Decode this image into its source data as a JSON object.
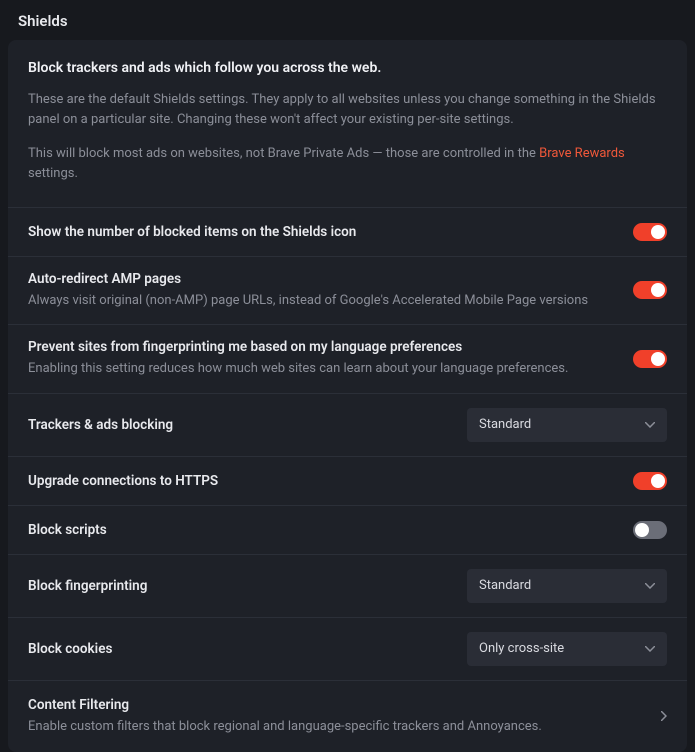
{
  "page_title": "Shields",
  "intro": {
    "title": "Block trackers and ads which follow you across the web.",
    "p1": "These are the default Shields settings. They apply to all websites unless you change something in the Shields panel on a particular site. Changing these won't affect your existing per-site settings.",
    "p2_pre": "This will block most ads on websites, not Brave Private Ads — those are controlled in the ",
    "p2_link": "Brave Rewards",
    "p2_post": " settings."
  },
  "rows": {
    "show_count": {
      "title": "Show the number of blocked items on the Shields icon"
    },
    "amp": {
      "title": "Auto-redirect AMP pages",
      "sub": "Always visit original (non-AMP) page URLs, instead of Google's Accelerated Mobile Page versions"
    },
    "lang_fp": {
      "title": "Prevent sites from fingerprinting me based on my language preferences",
      "sub": "Enabling this setting reduces how much web sites can learn about your language preferences."
    },
    "trackers": {
      "title": "Trackers & ads blocking",
      "value": "Standard"
    },
    "https": {
      "title": "Upgrade connections to HTTPS"
    },
    "scripts": {
      "title": "Block scripts"
    },
    "fingerprinting": {
      "title": "Block fingerprinting",
      "value": "Standard"
    },
    "cookies": {
      "title": "Block cookies",
      "value": "Only cross-site"
    },
    "content_filtering": {
      "title": "Content Filtering",
      "sub": "Enable custom filters that block regional and language-specific trackers and Annoyances."
    }
  }
}
